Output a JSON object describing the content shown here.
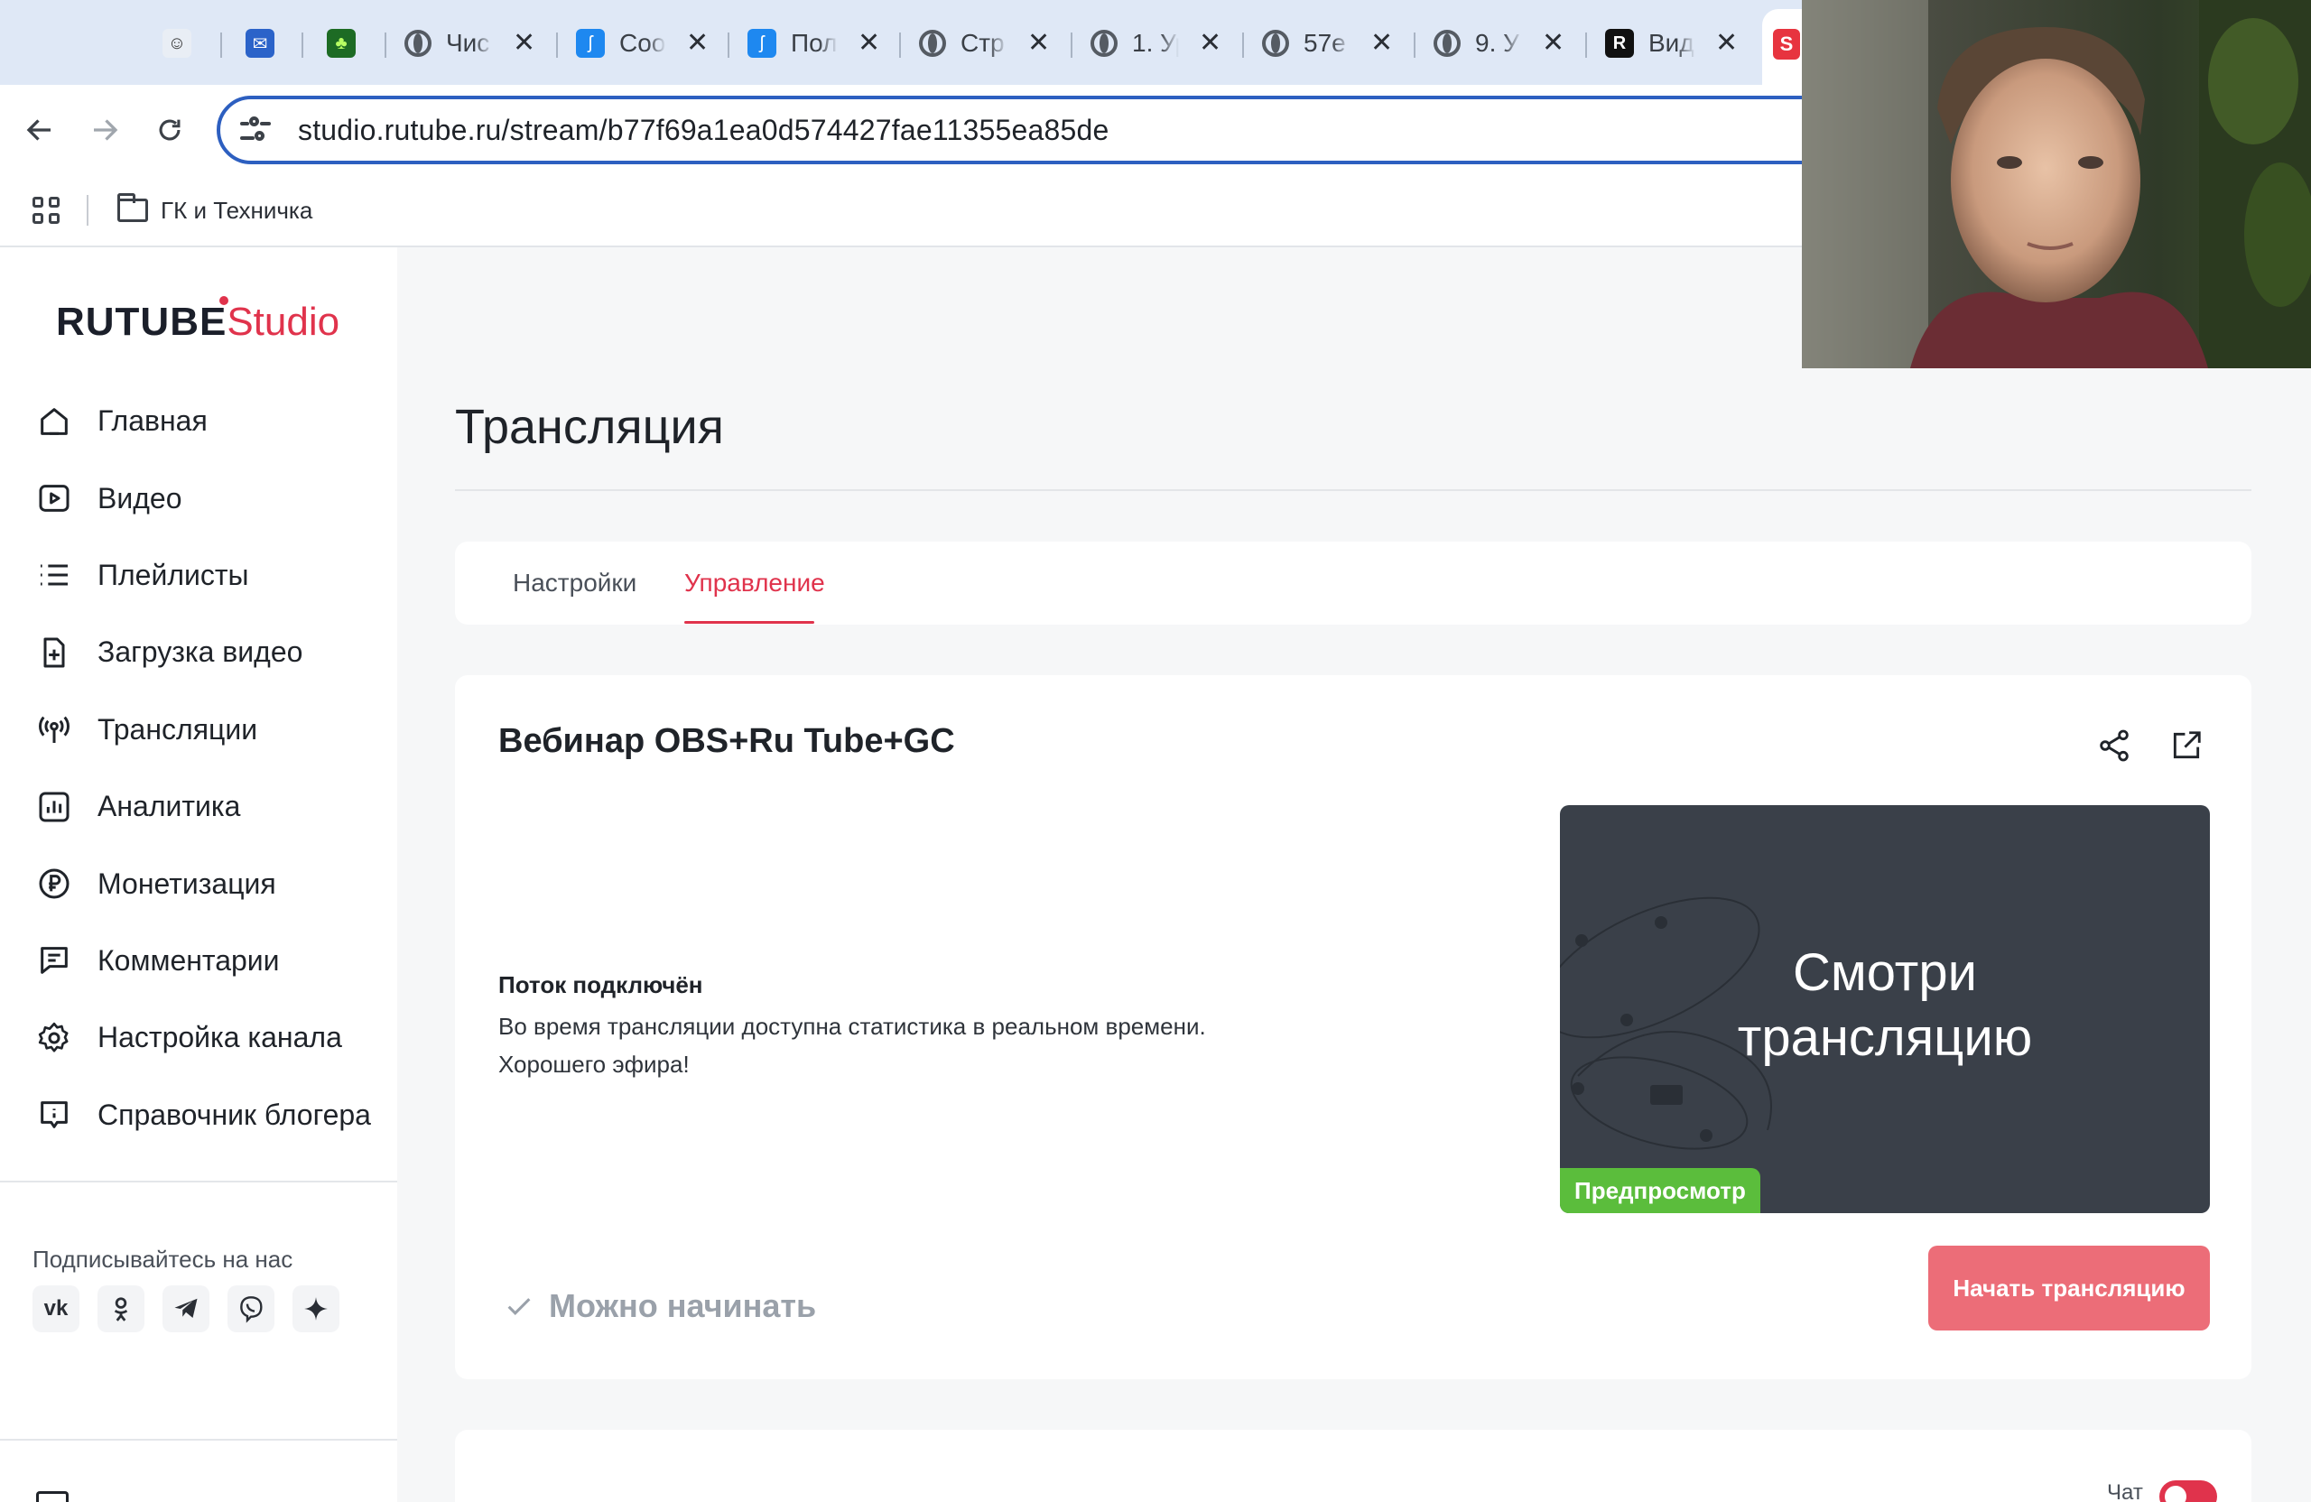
{
  "browser": {
    "tabs": [
      {
        "title": "",
        "icon": "avatar-icon"
      },
      {
        "title": "",
        "icon": "mail-icon"
      },
      {
        "title": "",
        "icon": "game-icon"
      },
      {
        "title": "Чис",
        "icon": "globe-icon"
      },
      {
        "title": "Соо",
        "icon": "bolt-icon"
      },
      {
        "title": "Пол",
        "icon": "bolt-icon"
      },
      {
        "title": "Стр",
        "icon": "globe-icon"
      },
      {
        "title": "1. Ур",
        "icon": "globe-icon"
      },
      {
        "title": "57е",
        "icon": "globe-icon"
      },
      {
        "title": "9. У",
        "icon": "globe-icon"
      },
      {
        "title": "Вид",
        "icon": "rutube-icon"
      }
    ],
    "url": "studio.rutube.ru/stream/b77f69a1ea0d574427fae11355ea85de",
    "bookmarks": [
      {
        "label": "ГК и Техничка"
      }
    ]
  },
  "sidebar": {
    "logo_main": "RUTUBE",
    "logo_studio": "Studio",
    "items": [
      {
        "label": "Главная",
        "icon": "home-icon"
      },
      {
        "label": "Видео",
        "icon": "video-icon"
      },
      {
        "label": "Плейлисты",
        "icon": "playlist-icon"
      },
      {
        "label": "Загрузка видео",
        "icon": "upload-icon"
      },
      {
        "label": "Трансляции",
        "icon": "broadcast-icon"
      },
      {
        "label": "Аналитика",
        "icon": "analytics-icon"
      },
      {
        "label": "Монетизация",
        "icon": "ruble-icon"
      },
      {
        "label": "Комментарии",
        "icon": "comment-icon"
      },
      {
        "label": "Настройка канала",
        "icon": "gear-icon"
      },
      {
        "label": "Справочник блогера",
        "icon": "info-icon"
      }
    ],
    "follow_title": "Подписывайтесь на нас",
    "socials": [
      "vk-icon",
      "ok-icon",
      "telegram-icon",
      "viber-icon",
      "dzen-icon"
    ]
  },
  "main": {
    "page_title": "Трансляция",
    "tabs": [
      {
        "label": "Настройки"
      },
      {
        "label": "Управление"
      }
    ],
    "active_tab": "Управление",
    "stream": {
      "title": "Вебинар OBS+Ru Tube+GC",
      "status_title": "Поток подключён",
      "status_line1": "Во время трансляции доступна статистика в реальном времени.",
      "status_line2": "Хорошего эфира!",
      "preview_line1": "Смотри",
      "preview_line2": "трансляцию",
      "preview_badge": "Предпросмотр",
      "ready_label": "Можно начинать",
      "start_button": "Начать трансляцию"
    },
    "chat_label": "Чат",
    "chat_enabled": true
  },
  "colors": {
    "accent": "#e0334c",
    "start_button": "#ec6d78",
    "preview_badge": "#5bbd3c",
    "omnibox_border": "#2d5fc0"
  }
}
